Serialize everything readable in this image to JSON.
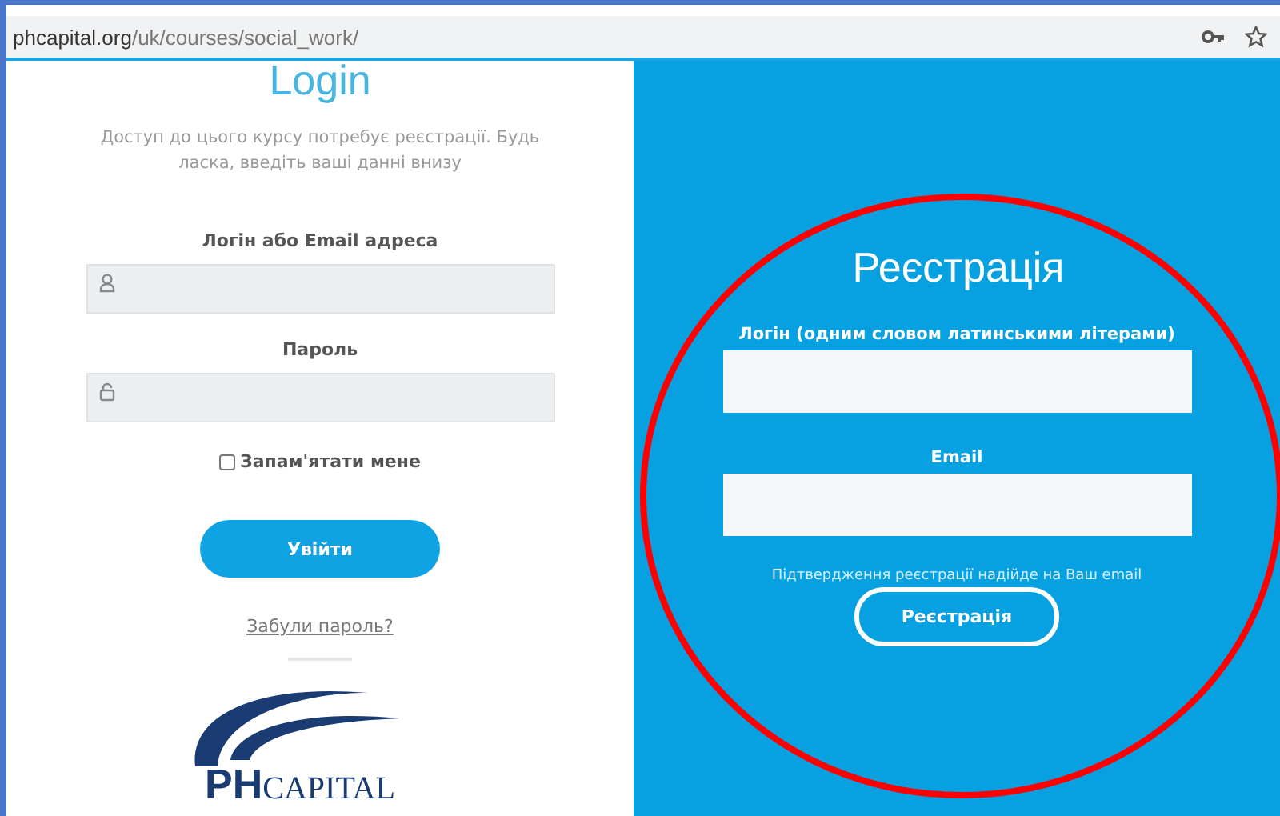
{
  "address_bar": {
    "url": "**phcapital.org**/uk/courses/social_work/"
  },
  "login": {
    "title": "Login",
    "description": "Доступ до цього курсу потребує реєстрації. Будь ласка, введіть ваші данні внизу",
    "fields": [
      {
        "label": "Логін або Email адреса",
        "kind": "user"
      },
      {
        "label": "Пароль",
        "kind": "lock"
      }
    ],
    "remember": {
      "label": "Запам'ятати мене",
      "checked": false
    },
    "submit": "Увійти",
    "forgot_link": "Забули пароль?",
    "logo": {
      "initials": "PH",
      "word": "CAPITAL"
    }
  },
  "register": {
    "title": "Реєстрація",
    "fields": [
      {
        "label": "Логін (одним словом латинськими літерами)"
      },
      {
        "label": "Email"
      }
    ],
    "note": "Підтвердження реєстрації надійде на Ваш email",
    "submit": "Реєстрація"
  },
  "annotation": {
    "kind": "ellipse",
    "color": "#ff0000"
  }
}
